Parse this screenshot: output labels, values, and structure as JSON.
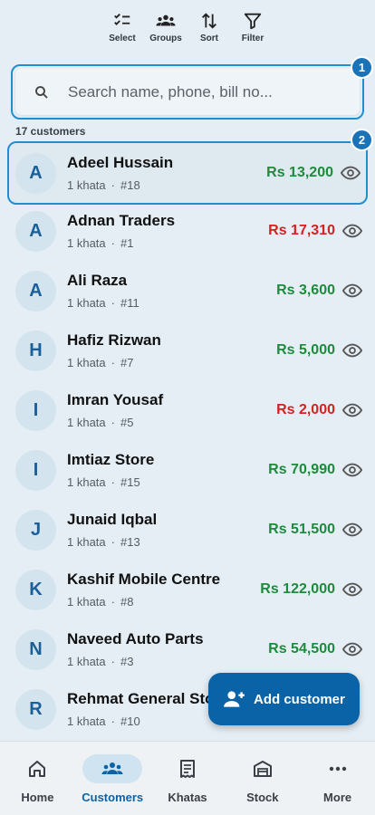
{
  "toolbar": {
    "items": [
      {
        "label": "Select",
        "icon": "checklist-icon"
      },
      {
        "label": "Groups",
        "icon": "groups-icon"
      },
      {
        "label": "Sort",
        "icon": "sort-icon"
      },
      {
        "label": "Filter",
        "icon": "filter-icon"
      }
    ]
  },
  "search": {
    "placeholder": "Search name, phone, bill no..."
  },
  "annotations": {
    "badge1": "1",
    "badge2": "2"
  },
  "customer_count": "17 customers",
  "customers": [
    {
      "initial": "A",
      "name": "Adeel Hussain",
      "khata": "1 khata",
      "dot": "·",
      "bill": "#18",
      "amount": "Rs 13,200",
      "status": "green"
    },
    {
      "initial": "A",
      "name": "Adnan Traders",
      "khata": "1 khata",
      "dot": "·",
      "bill": "#1",
      "amount": "Rs 17,310",
      "status": "red"
    },
    {
      "initial": "A",
      "name": "Ali Raza",
      "khata": "1 khata",
      "dot": "·",
      "bill": "#11",
      "amount": "Rs 3,600",
      "status": "green"
    },
    {
      "initial": "H",
      "name": "Hafiz Rizwan",
      "khata": "1 khata",
      "dot": "·",
      "bill": "#7",
      "amount": "Rs 5,000",
      "status": "green"
    },
    {
      "initial": "I",
      "name": "Imran Yousaf",
      "khata": "1 khata",
      "dot": "·",
      "bill": "#5",
      "amount": "Rs 2,000",
      "status": "red"
    },
    {
      "initial": "I",
      "name": "Imtiaz Store",
      "khata": "1 khata",
      "dot": "·",
      "bill": "#15",
      "amount": "Rs 70,990",
      "status": "green"
    },
    {
      "initial": "J",
      "name": "Junaid Iqbal",
      "khata": "1 khata",
      "dot": "·",
      "bill": "#13",
      "amount": "Rs 51,500",
      "status": "green"
    },
    {
      "initial": "K",
      "name": "Kashif Mobile Centre",
      "khata": "1 khata",
      "dot": "·",
      "bill": "#8",
      "amount": "Rs 122,000",
      "status": "green"
    },
    {
      "initial": "N",
      "name": "Naveed Auto Parts",
      "khata": "1 khata",
      "dot": "·",
      "bill": "#3",
      "amount": "Rs 54,500",
      "status": "green"
    },
    {
      "initial": "R",
      "name": "Rehmat General Store",
      "khata": "1 khata",
      "dot": "·",
      "bill": "#10",
      "amount": "",
      "status": "green"
    }
  ],
  "fab": {
    "label": "Add customer",
    "icon": "person-add-icon"
  },
  "nav": {
    "items": [
      {
        "label": "Home",
        "icon": "home-icon"
      },
      {
        "label": "Customers",
        "icon": "groups-icon",
        "active": true
      },
      {
        "label": "Khatas",
        "icon": "receipt-icon"
      },
      {
        "label": "Stock",
        "icon": "warehouse-icon"
      },
      {
        "label": "More",
        "icon": "more-icon"
      }
    ]
  },
  "colors": {
    "accent": "#0a63a6",
    "positive": "#1e8a3c",
    "negative": "#d32222",
    "highlight": "#1f8fd1"
  }
}
